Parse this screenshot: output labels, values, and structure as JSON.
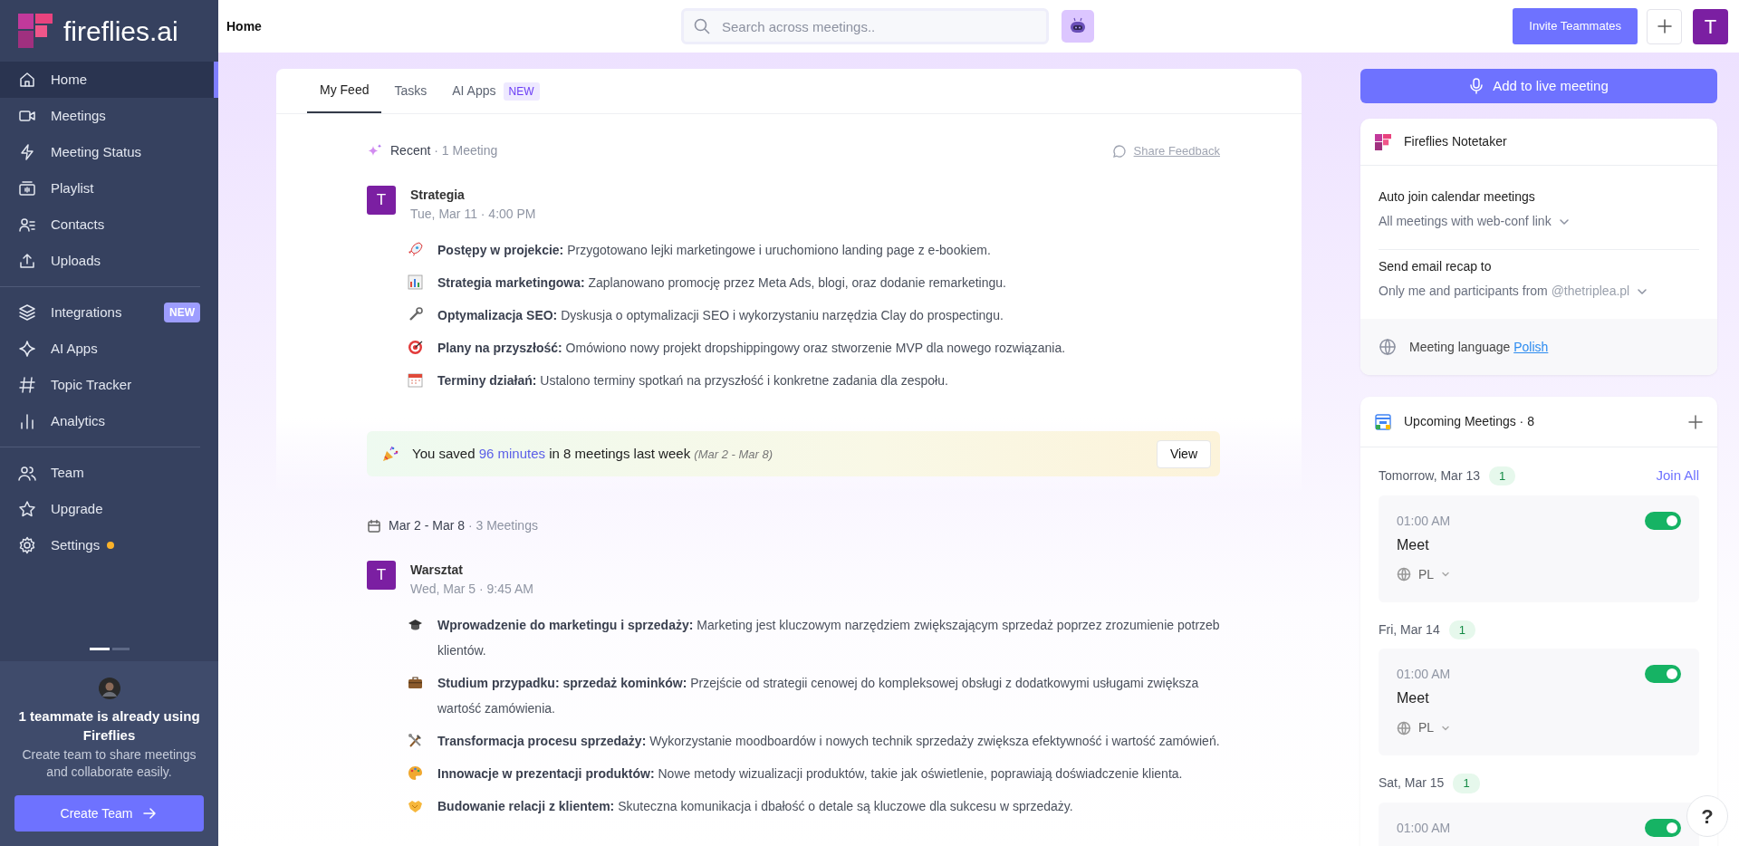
{
  "sidebar": {
    "logo": "fireflies.ai",
    "groups": [
      [
        {
          "label": "Home",
          "selected": true,
          "alert": false
        },
        {
          "label": "Meetings",
          "selected": false,
          "alert": false
        },
        {
          "label": "Meeting Status",
          "selected": false,
          "alert": false
        },
        {
          "label": "Playlist",
          "selected": false,
          "alert": false
        },
        {
          "label": "Contacts",
          "selected": false,
          "alert": false
        },
        {
          "label": "Uploads",
          "selected": false,
          "alert": false
        }
      ],
      [
        {
          "label": "Integrations",
          "selected": false,
          "alert": false,
          "badge": "NEW"
        },
        {
          "label": "AI Apps",
          "selected": false,
          "alert": false
        },
        {
          "label": "Topic Tracker",
          "selected": false,
          "alert": false
        },
        {
          "label": "Analytics",
          "selected": false,
          "alert": false
        }
      ],
      [
        {
          "label": "Team",
          "selected": false,
          "alert": false
        },
        {
          "label": "Upgrade",
          "selected": false,
          "alert": false
        },
        {
          "label": "Settings",
          "selected": false,
          "alert": true
        }
      ]
    ],
    "promo": {
      "title": "1 teammate is already using Fireflies",
      "text": "Create team to share meetings and collaborate easily.",
      "button": "Create Team"
    }
  },
  "topbar": {
    "title": "Home",
    "search": {
      "placeholder": "Search across meetings.."
    },
    "invite_button": "Invite Teammates",
    "avatar": "T"
  },
  "feed": {
    "tabs": [
      {
        "label": "My Feed",
        "selected": true
      },
      {
        "label": "Tasks",
        "selected": false
      },
      {
        "label": "AI Apps",
        "selected": false,
        "badge": "NEW"
      }
    ],
    "sections": [
      {
        "kind": "recent",
        "title": "Recent",
        "count": "· 1 Meeting",
        "feedback": "Share Feedback",
        "meetings": [
          {
            "avatar": "T",
            "title": "Strategia",
            "time": "Tue, Mar 11 · 4:00 PM",
            "points": [
              "**Postępy w projekcie:** Przygotowano lejki marketingowe i uruchomiono landing page z e-bookiem.",
              "**Strategia marketingowa:** Zaplanowano promocję przez Meta Ads, blogi, oraz dodanie remarketingu.",
              "**Optymalizacja SEO:** Dyskusja o optymalizacji SEO i wykorzystaniu narzędzia Clay do prospectingu.",
              "**Plany na przyszłość:** Omówiono nowy projekt dropshippingowy oraz stworzenie MVP dla nowego rozwiązania.",
              "**Terminy działań:** Ustalono terminy spotkań na przyszłość i konkretne zadania dla zespołu."
            ]
          }
        ],
        "savings": {
          "prefix": "You saved",
          "highlight": "96 minutes",
          "suffix": "in 8 meetings last week",
          "range": "(Mar 2 - Mar 8)",
          "button": "View"
        }
      },
      {
        "kind": "week",
        "title": "Mar 2 - Mar 8",
        "count": "· 3 Meetings",
        "meetings": [
          {
            "avatar": "T",
            "title": "Warsztat",
            "time": "Wed, Mar 5 · 9:45 AM",
            "points": [
              "**Wprowadzenie do marketingu i sprzedaży:** Marketing jest kluczowym narzędziem zwiększającym sprzedaż poprzez zrozumienie potrzeb klientów.",
              "**Studium przypadku: sprzedaż kominków:** Przejście od strategii cenowej do kompleksowej obsługi z dodatkowymi usługami zwiększa wartość zamówienia.",
              "**Transformacja procesu sprzedaży:** Wykorzystanie moodboardów i nowych technik sprzedaży zwiększa efektywność i wartość zamówień.",
              "**Innowacje w prezentacji produktów:** Nowe metody wizualizacji produktów, takie jak oświetlenie, poprawiają doświadczenie klienta.",
              "**Budowanie relacji z klientem:** Skuteczna komunikacja i dbałość o detale są kluczowe dla sukcesu w sprzedaży."
            ]
          }
        ]
      }
    ]
  },
  "right": {
    "live_button": "Add to live meeting",
    "notetaker": {
      "title": "Fireflies Notetaker",
      "settings": [
        {
          "label": "Auto join calendar meetings",
          "value": "All meetings with web-conf link"
        },
        {
          "label": "Send email recap to",
          "value": "Only me and participants from",
          "domain": "@thetriplea.pl"
        }
      ],
      "language_label": "Meeting language",
      "language": "Polish"
    },
    "upcoming": {
      "title": "Upcoming Meetings · 8",
      "join_all": "Join All",
      "days": [
        {
          "date": "Tomorrow, Mar 13",
          "count": "1",
          "meetings": [
            {
              "time": "01:00 AM",
              "title": "Meet",
              "language": "PL",
              "on": true
            }
          ]
        },
        {
          "date": "Fri, Mar 14",
          "count": "1",
          "meetings": [
            {
              "time": "01:00 AM",
              "title": "Meet",
              "language": "PL",
              "on": true
            }
          ]
        },
        {
          "date": "Sat, Mar 15",
          "count": "1",
          "meetings": [
            {
              "time": "01:00 AM",
              "on": true
            }
          ]
        }
      ]
    }
  },
  "help": "?"
}
